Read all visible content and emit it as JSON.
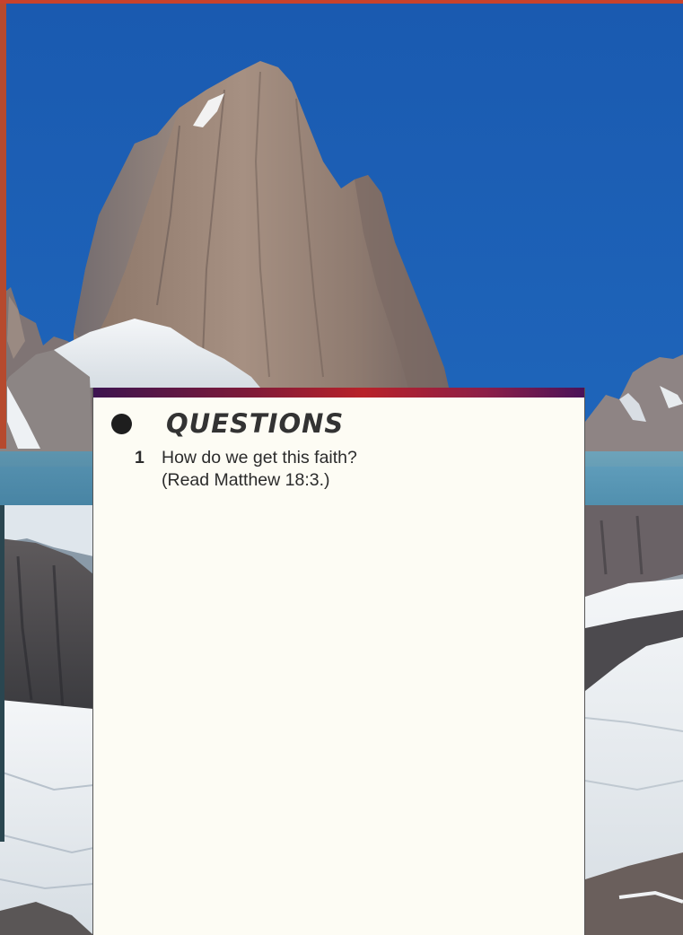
{
  "questions_panel": {
    "heading": "QUESTIONS",
    "items": [
      {
        "number": "1",
        "line1": "How do we get this faith?",
        "line2": "(Read Matthew 18:3.)"
      }
    ]
  },
  "photo": {
    "subject": "granite mountain peak with glaciers under blue sky"
  },
  "colors": {
    "sky": "#1f63b4",
    "card_background": "#fdfcf4",
    "accent_red": "#b8222a",
    "accent_purple": "#3d1450"
  }
}
